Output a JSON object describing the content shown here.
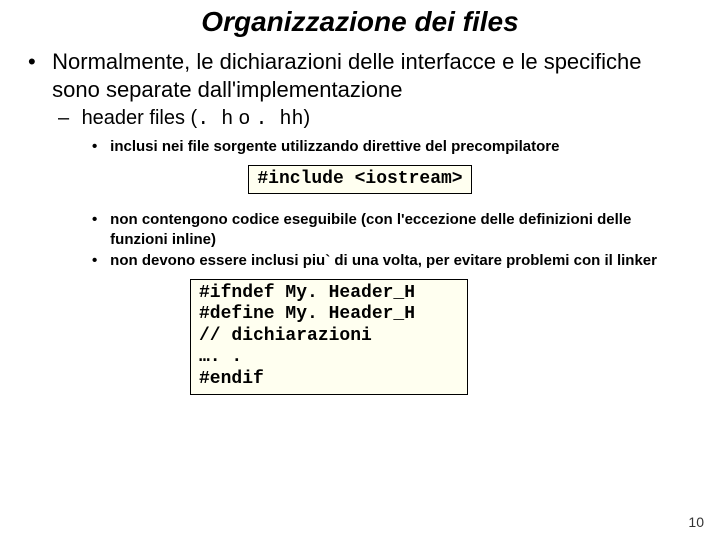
{
  "title": "Organizzazione dei files",
  "bullet1": "Normalmente, le dichiarazioni delle interfacce e le specifiche sono separate dall'implementazione",
  "sub1_prefix": "header files (",
  "sub1_code1": ". h",
  "sub1_mid": " o ",
  "sub1_code2": ". hh",
  "sub1_suffix": ")",
  "sub_a": "inclusi nei file sorgente utilizzando direttive del precompilatore",
  "code1": "#include <iostream>",
  "sub_b": "non contengono codice eseguibile (con l'eccezione delle definizioni delle funzioni inline)",
  "sub_c": "non devono essere inclusi piu` di una volta, per evitare problemi con il linker",
  "code2_l1": "#ifndef My. Header_H",
  "code2_l2": "#define My. Header_H",
  "code2_l3": "// dichiarazioni",
  "code2_l4": "…. .",
  "code2_l5": "#endif",
  "pagenum": "10"
}
